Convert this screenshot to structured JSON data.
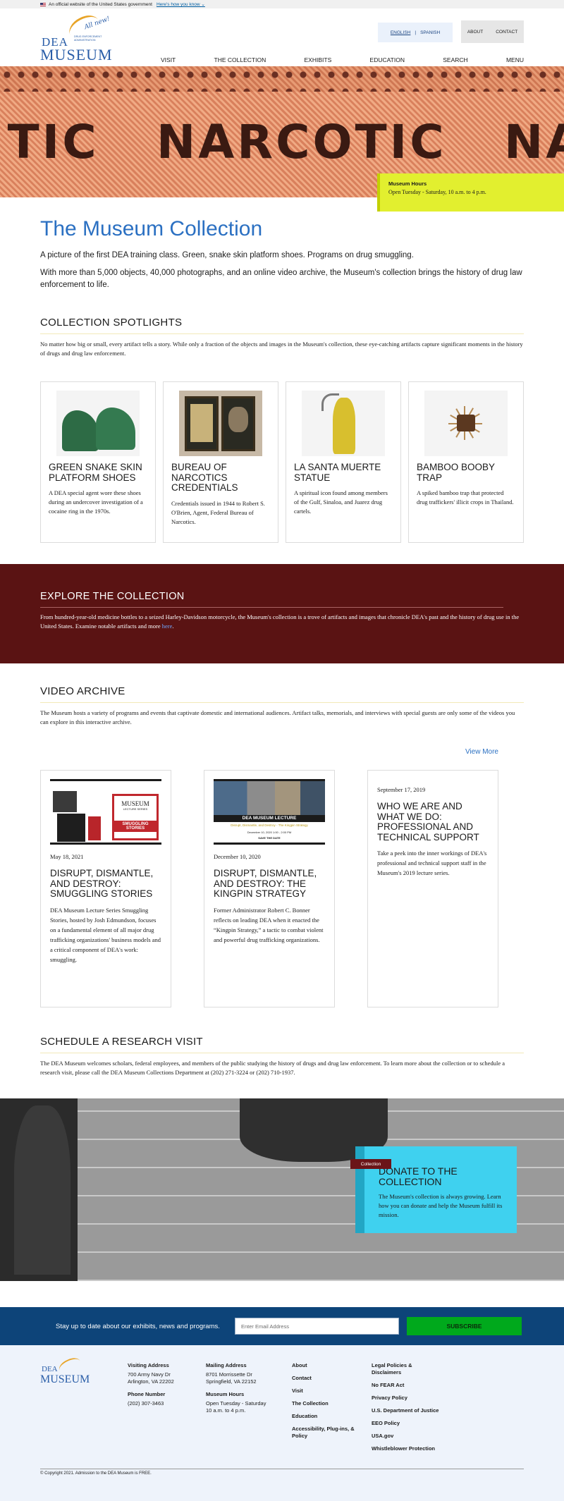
{
  "gov_banner": {
    "text": "An official website of the United States government",
    "link": "Here's how you know"
  },
  "logo": {
    "script": "All new!",
    "dea": "DEA",
    "museum": "MUSEUM",
    "admin": "DRUG ENFORCEMENT ADMINISTRATION",
    "footer_dea": "DEA",
    "footer_museum": "MUSEUM"
  },
  "language": {
    "english": "ENGLISH",
    "separator": "|",
    "spanish": "SPANISH"
  },
  "utility": {
    "about": "ABOUT",
    "contact": "CONTACT"
  },
  "nav": [
    {
      "label": "VISIT"
    },
    {
      "label": "THE COLLECTION"
    },
    {
      "label": "EXHIBITS"
    },
    {
      "label": "EDUCATION"
    },
    {
      "label": "SEARCH"
    },
    {
      "label": "MENU"
    }
  ],
  "hero": {
    "stamp_words": [
      "TIC",
      "NARCOTIC",
      "NA"
    ],
    "hours_title": "Museum Hours",
    "hours_value": "Open Tuesday - Saturday, 10 a.m. to 4 p.m."
  },
  "intro": {
    "title": "The Museum Collection",
    "lead": "A picture of the first DEA training class. Green, snake skin platform shoes. Programs on drug smuggling.",
    "lead2": "With more than 5,000 objects, 40,000 photographs, and an online video archive, the Museum's collection brings the history of drug law enforcement to life."
  },
  "spotlights": {
    "heading": "COLLECTION SPOTLIGHTS",
    "text": "No matter how big or small, every artifact tells a story. While only a fraction of the objects and images in the Museum's collection, these eye-catching artifacts capture significant moments in the history of drugs and drug law enforcement.",
    "cards": [
      {
        "title": "GREEN SNAKE SKIN PLATFORM SHOES",
        "desc": "A DEA special agent wore these shoes during an undercover investigation of a cocaine ring in the 1970s."
      },
      {
        "title": "BUREAU OF NARCOTICS CREDENTIALS",
        "desc": "Credentials issued in 1944 to Robert S. O'Brien, Agent, Federal Bureau of Narcotics."
      },
      {
        "title": "LA SANTA MUERTE STATUE",
        "desc": "A spiritual icon found among members of the Gulf, Sinaloa, and Juarez drug cartels."
      },
      {
        "title": "BAMBOO BOOBY TRAP",
        "desc": "A spiked bamboo trap that protected drug traffickers' illicit crops in Thailand."
      }
    ]
  },
  "explore": {
    "heading": "EXPLORE THE COLLECTION",
    "text": "From hundred-year-old medicine bottles to a seized Harley-Davidson motorcycle, the Museum's collection is a trove of artifacts and images that chronicle DEA's past and the history of drug use in the United States. Examine notable artifacts and more",
    "link": "here",
    "end": "."
  },
  "video": {
    "heading": "VIDEO ARCHIVE",
    "text": "The Museum hosts a variety of programs and events that captivate domestic and international audiences. Artifact talks, memorials, and interviews with special guests are only some of the videos you can explore in this interactive archive.",
    "view_more": "View More",
    "cards": [
      {
        "date": "May 18, 2021",
        "title": "DISRUPT, DISMANTLE, AND DESTROY: SMUGGLING STORIES",
        "desc": "DEA Museum Lecture Series Smuggling Stories, hosted by Josh Edmundson, focuses on a fundamental element of all major drug trafficking organizations' business models and a critical component of DEA's work: smuggling.",
        "img_line1": "MUSEUM",
        "img_line2": "LECTURE SERIES",
        "img_line3": "SMUGGLING STORIES"
      },
      {
        "date": "December 10, 2020",
        "title": "DISRUPT, DISMANTLE, AND DESTROY: THE KINGPIN STRATEGY",
        "desc": "Former Administrator Robert C. Bonner reflects on leading DEA when it enacted the “Kingpin Strategy,” a tactic to combat violent and powerful drug trafficking organizations.",
        "img_line1": "DEA MUSEUM LECTURE",
        "img_line2": "Disrupt, Dismantle, and Destroy - The Kingpin Strategy",
        "img_line3": "December 10, 2020 1:00 - 2:00 PM",
        "img_line4": "SAVE THE DATE"
      },
      {
        "date": "September 17, 2019",
        "title": "WHO WE ARE AND WHAT WE DO: PROFESSIONAL AND TECHNICAL SUPPORT",
        "desc": "Take a peek into the inner workings of DEA's professional and technical support staff in the Museum's 2019 lecture series."
      }
    ]
  },
  "research": {
    "heading": "SCHEDULE A RESEARCH VISIT",
    "text": "The DEA Museum welcomes scholars, federal employees, and members of the public studying the history of drugs and drug law enforcement. To learn more about the collection or to schedule a research visit, please call the DEA Museum Collections Department at (202) 271-3224 or (202) 710-1937."
  },
  "donate": {
    "tag": "Collection",
    "title": "DONATE TO THE COLLECTION",
    "text": "The Museum's collection is always growing. Learn how you can donate and help the Museum fulfill its mission."
  },
  "newsletter": {
    "text": "Stay up to date about our exhibits, news and programs.",
    "placeholder": "Enter Email Address",
    "button": "SUBSCRIBE"
  },
  "footer": {
    "visiting_label": "Visiting Address",
    "visiting_line1": "700 Army Navy Dr",
    "visiting_line2": "Arlington, VA 22202",
    "phone_label": "Phone Number",
    "phone": "(202) 307-3463",
    "mailing_label": "Mailing Address",
    "mailing_line1": "8701 Morrissette Dr",
    "mailing_line2": "Springfield, VA 22152",
    "hours_label": "Museum Hours",
    "hours_line1": "Open Tuesday - Saturday",
    "hours_line2": "10 a.m. to 4 p.m.",
    "links1": [
      "About",
      "Contact",
      "Visit",
      "The Collection",
      "Education",
      "Accessibility, Plug-ins, & Policy"
    ],
    "links2": [
      "Legal Policies & Disclaimers",
      "No FEAR Act",
      "Privacy Policy",
      "U.S. Department of Justice",
      "EEO Policy",
      "USA.gov",
      "Whistleblower Protection"
    ],
    "copyright": "© Copyright 2021. Admission to the DEA Museum is FREE."
  },
  "colors": {
    "brand_blue": "#2b70c2",
    "accent_gold": "#e8a427",
    "explore_bg": "#5a1313",
    "hours_bg": "#e2ef2f",
    "donate_bg": "#3fd1ef",
    "newsletter_bg": "#0d4479",
    "subscribe_bg": "#00a91c"
  },
  "icons": [
    "us-flag-icon",
    "chevron-down-icon"
  ]
}
